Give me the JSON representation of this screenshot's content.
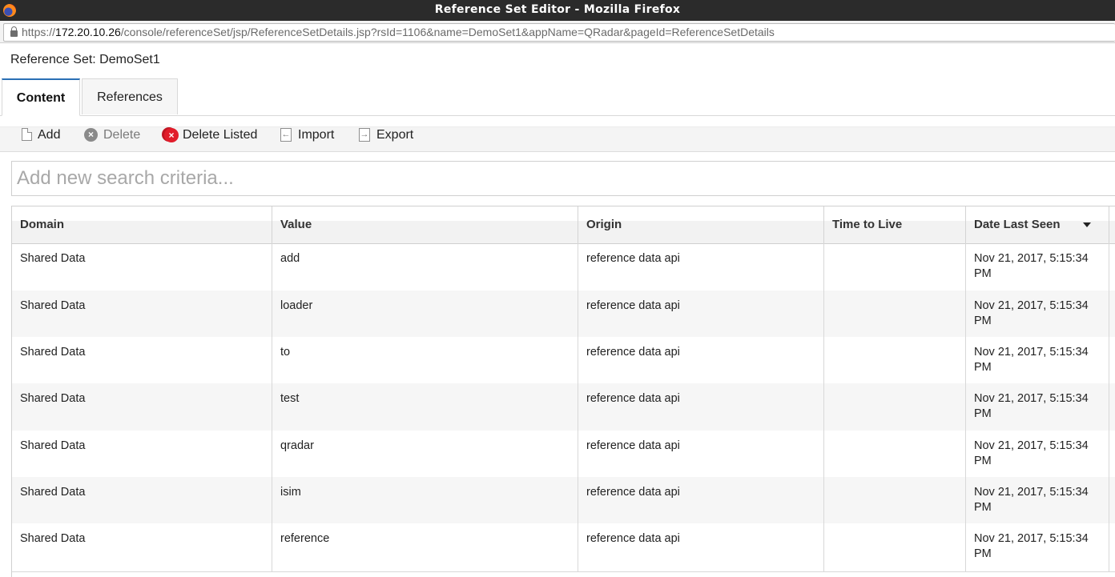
{
  "window": {
    "title": "Reference Set Editor - Mozilla Firefox"
  },
  "urlbar": {
    "scheme": "https://",
    "host": "172.20.10.26",
    "path": "/console/referenceSet/jsp/ReferenceSetDetails.jsp?rsId=1106&name=DemoSet1&appName=QRadar&pageId=ReferenceSetDetails"
  },
  "page": {
    "title": "Reference Set: DemoSet1"
  },
  "tabs": [
    {
      "label": "Content",
      "active": true
    },
    {
      "label": "References",
      "active": false
    }
  ],
  "toolbar": {
    "add": "Add",
    "delete": "Delete",
    "delete_listed": "Delete Listed",
    "import": "Import",
    "export": "Export"
  },
  "search": {
    "placeholder": "Add new search criteria..."
  },
  "table": {
    "columns": [
      "Domain",
      "Value",
      "Origin",
      "Time to Live",
      "Date Last Seen"
    ],
    "sorted_by": "Date Last Seen",
    "sort_direction": "descending",
    "rows": [
      {
        "domain": "Shared Data",
        "value": "add",
        "origin": "reference data api",
        "ttl": "",
        "last_seen": "Nov 21, 2017, 5:15:34 PM"
      },
      {
        "domain": "Shared Data",
        "value": "loader",
        "origin": "reference data api",
        "ttl": "",
        "last_seen": "Nov 21, 2017, 5:15:34 PM"
      },
      {
        "domain": "Shared Data",
        "value": "to",
        "origin": "reference data api",
        "ttl": "",
        "last_seen": "Nov 21, 2017, 5:15:34 PM"
      },
      {
        "domain": "Shared Data",
        "value": "test",
        "origin": "reference data api",
        "ttl": "",
        "last_seen": "Nov 21, 2017, 5:15:34 PM"
      },
      {
        "domain": "Shared Data",
        "value": "qradar",
        "origin": "reference data api",
        "ttl": "",
        "last_seen": "Nov 21, 2017, 5:15:34 PM"
      },
      {
        "domain": "Shared Data",
        "value": "isim",
        "origin": "reference data api",
        "ttl": "",
        "last_seen": "Nov 21, 2017, 5:15:34 PM"
      },
      {
        "domain": "Shared Data",
        "value": "reference",
        "origin": "reference data api",
        "ttl": "",
        "last_seen": "Nov 21, 2017, 5:15:34 PM"
      }
    ]
  },
  "icons": {
    "browser": "firefox-icon",
    "lock": "lock-icon",
    "add": "document-icon",
    "delete": "delete-circle-icon",
    "delete_listed": "delete-multiple-icon",
    "import": "import-icon",
    "export": "export-icon",
    "sort": "sort-descending-icon"
  },
  "colors": {
    "titlebar": "#2b2b2b",
    "active_tab_accent": "#2a6fb5",
    "delete_listed_icon": "#e11c2a"
  }
}
